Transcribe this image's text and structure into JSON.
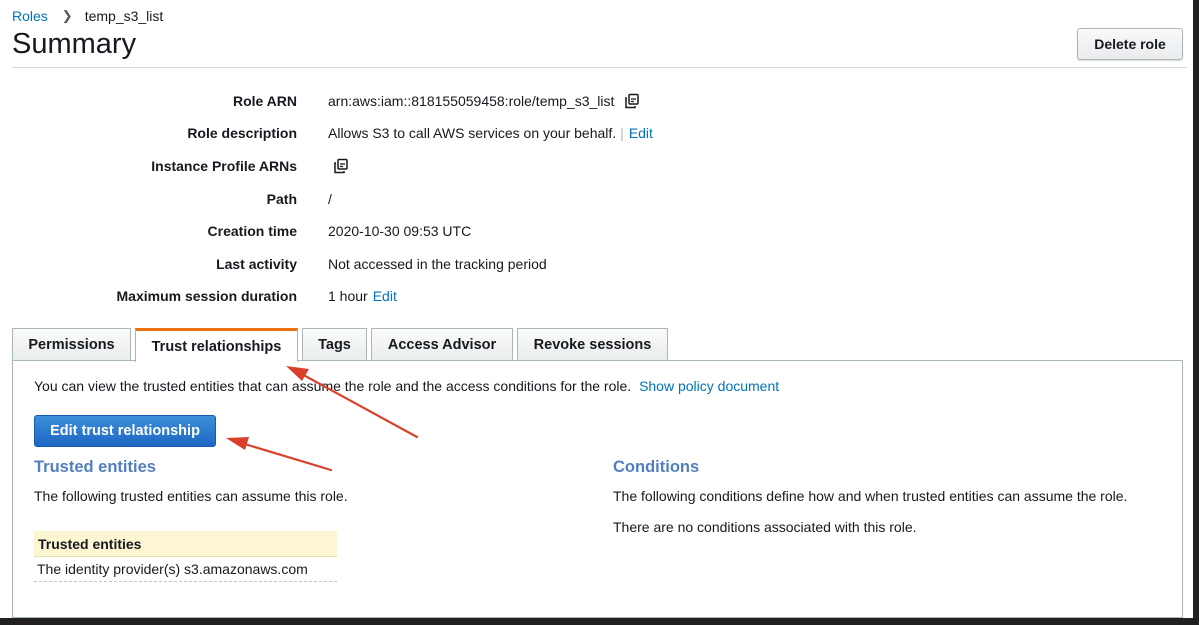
{
  "breadcrumb": {
    "parent": "Roles",
    "current": "temp_s3_list"
  },
  "page": {
    "title": "Summary",
    "delete_button": "Delete role"
  },
  "summary": {
    "role_arn_label": "Role ARN",
    "role_arn_value": "arn:aws:iam::818155059458:role/temp_s3_list",
    "role_description_label": "Role description",
    "role_description_value": "Allows S3 to call AWS services on your behalf.",
    "edit_label": "Edit",
    "instance_profile_label": "Instance Profile ARNs",
    "path_label": "Path",
    "path_value": "/",
    "creation_time_label": "Creation time",
    "creation_time_value": "2020-10-30 09:53 UTC",
    "last_activity_label": "Last activity",
    "last_activity_value": "Not accessed in the tracking period",
    "max_session_label": "Maximum session duration",
    "max_session_value": "1 hour"
  },
  "tabs": {
    "permissions": "Permissions",
    "trust_relationships": "Trust relationships",
    "tags": "Tags",
    "access_advisor": "Access Advisor",
    "revoke_sessions": "Revoke sessions",
    "active": "trust_relationships"
  },
  "trust": {
    "intro": "You can view the trusted entities that can assume the role and the access conditions for the role.",
    "show_policy_link": "Show policy document",
    "edit_button": "Edit trust relationship",
    "trusted_heading": "Trusted entities",
    "trusted_description": "The following trusted entities can assume this role.",
    "table_header": "Trusted entities",
    "table_rows": [
      "The identity provider(s) s3.amazonaws.com"
    ],
    "conditions_heading": "Conditions",
    "conditions_description": "The following conditions define how and when trusted entities can assume the role.",
    "conditions_empty": "There are no conditions associated with this role."
  },
  "icons": {
    "copy": "copy-icon",
    "chevron": "chevron-right-icon"
  },
  "colors": {
    "accent_tab": "#ec7211",
    "link": "#0073bb",
    "primary_button": "#1d67c4",
    "section_heading": "#527fc0",
    "annotation_arrow": "#d9412b"
  }
}
